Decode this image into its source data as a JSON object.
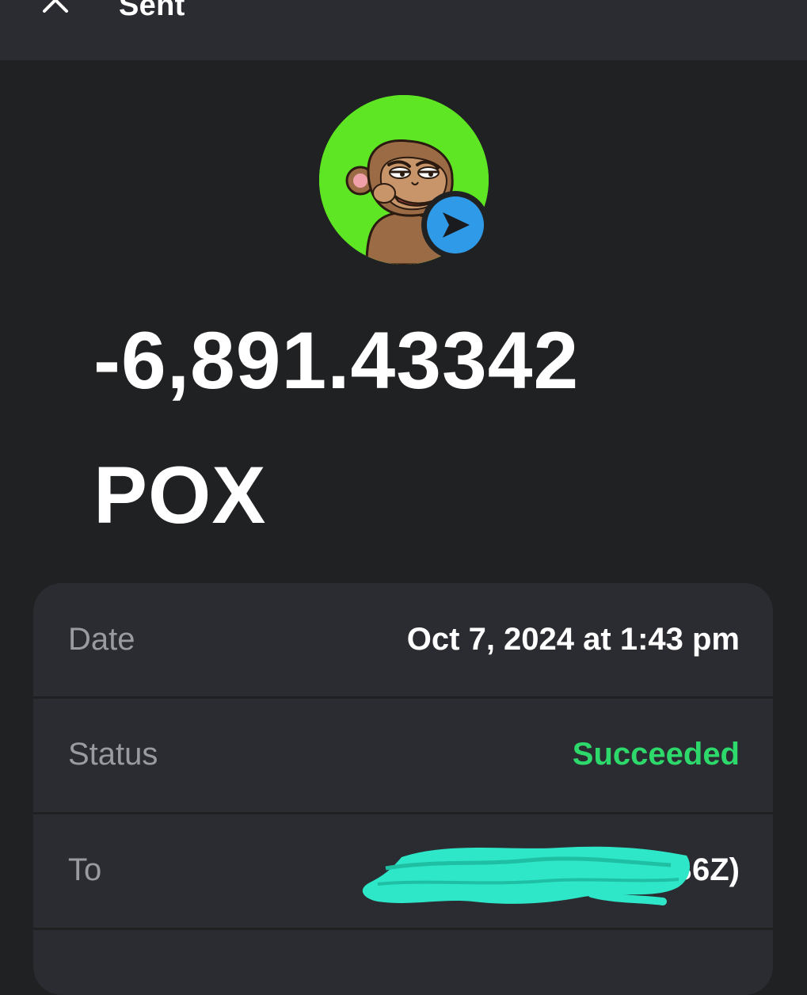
{
  "header": {
    "title": "Sent",
    "close_icon": "close-icon"
  },
  "token": {
    "avatar_icon": "token-avatar-monkey",
    "badge_icon": "send-arrow-icon",
    "colors": {
      "avatar_background": "#5ee523",
      "badge": "#2f9be8"
    }
  },
  "amount": {
    "value": "-6,891.43342",
    "symbol": "POX"
  },
  "details": {
    "date": {
      "label": "Date",
      "value": "Oct 7, 2024 at 1:43 pm"
    },
    "status": {
      "label": "Status",
      "value": "Succeeded",
      "color": "#2ed96b"
    },
    "to": {
      "label": "To",
      "value": "B6Z)",
      "redaction_color": "#2ee6c8"
    }
  }
}
